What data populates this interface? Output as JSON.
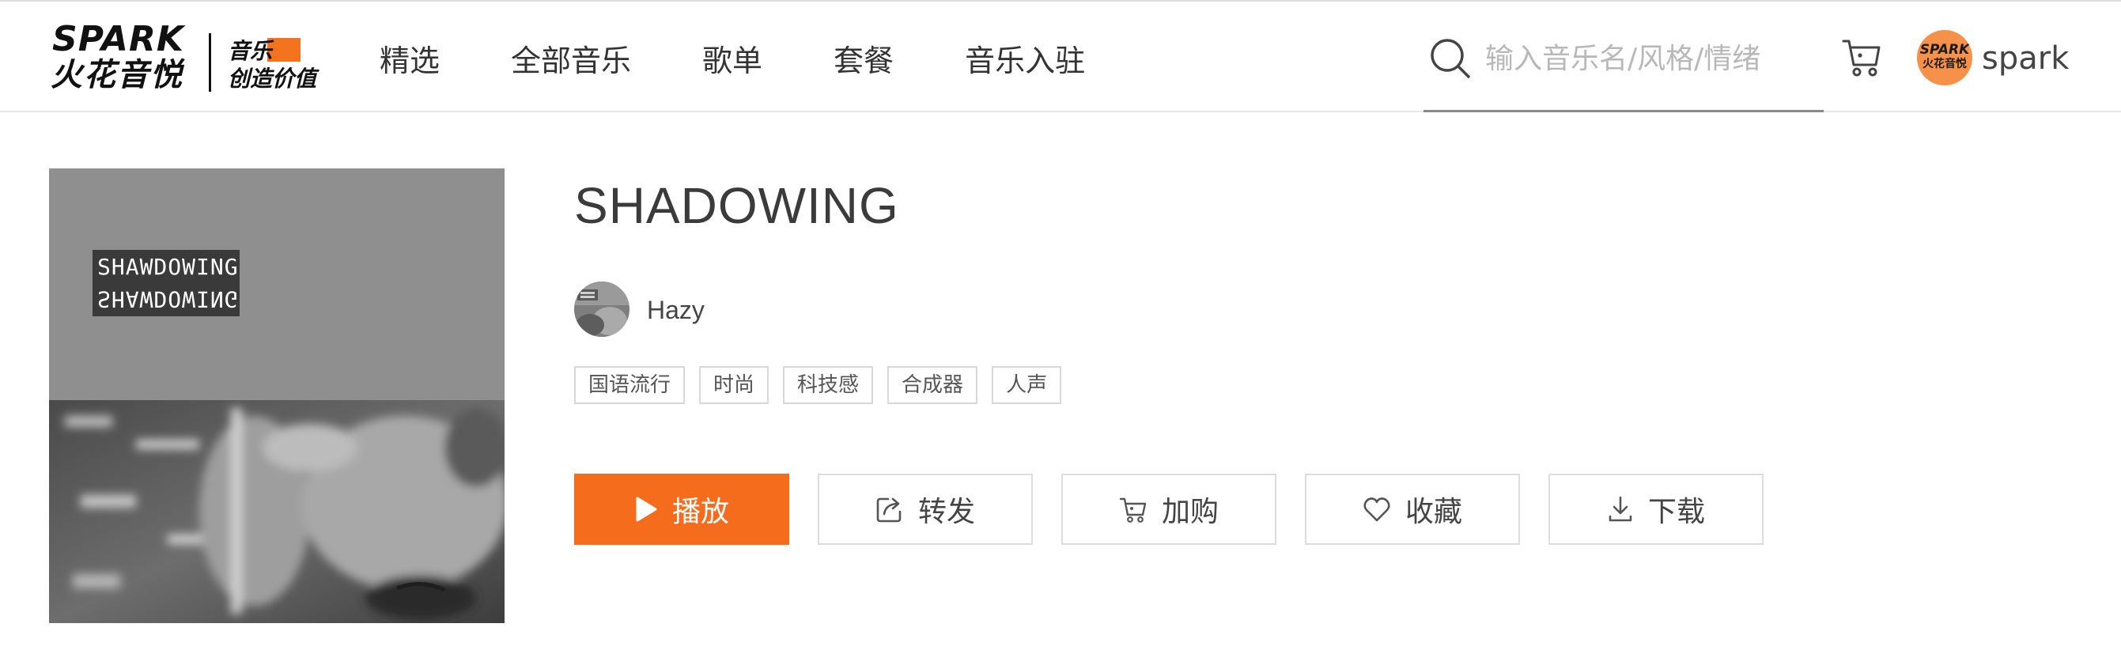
{
  "header": {
    "logo": {
      "wordmark": "SPARK",
      "cn_name": "火花音悦",
      "slogan_line1": "音乐",
      "slogan_line2": "创造价值"
    },
    "nav": [
      {
        "label": "精选"
      },
      {
        "label": "全部音乐"
      },
      {
        "label": "歌单"
      },
      {
        "label": "套餐"
      },
      {
        "label": "音乐入驻"
      }
    ],
    "search": {
      "placeholder": "输入音乐名/风格/情绪",
      "value": "",
      "icon": "search-icon"
    },
    "cart_icon": "cart-icon",
    "user": {
      "avatar_text_line1": "SPARK",
      "avatar_text_line2": "火花音悦",
      "avatar_color": "#f69149",
      "name": "spark"
    }
  },
  "album": {
    "cover_text_line1": "SHAWDOWING",
    "cover_text_line2": "SHAWDOWING"
  },
  "song": {
    "title": "SHADOWING",
    "artist": "Hazy",
    "tags": [
      "国语流行",
      "时尚",
      "科技感",
      "合成器",
      "人声"
    ]
  },
  "actions": [
    {
      "label": "播放",
      "icon": "play-icon",
      "primary": true
    },
    {
      "label": "转发",
      "icon": "share-icon",
      "primary": false
    },
    {
      "label": "加购",
      "icon": "cart-icon",
      "primary": false
    },
    {
      "label": "收藏",
      "icon": "heart-icon",
      "primary": false
    },
    {
      "label": "下载",
      "icon": "download-icon",
      "primary": false
    }
  ],
  "colors": {
    "accent": "#f46c1c",
    "text": "#333333",
    "border": "#dcdcdc"
  }
}
